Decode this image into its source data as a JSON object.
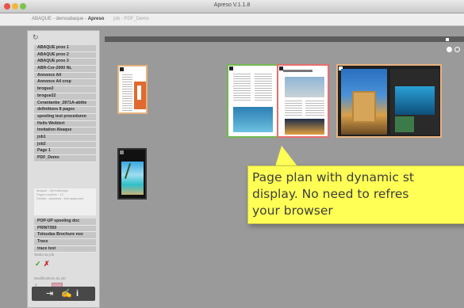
{
  "window": {
    "title": "Apreso V.1.1.8"
  },
  "toolbar": {
    "breadcrumb_left": "ABAQUE - demoabaque -",
    "breadcrumb_bold": "Apreso",
    "breadcrumb_job": "job - PDF_Demo"
  },
  "sidebar": {
    "items": [
      "ABAQUE proo 1",
      "ABAQUE proo 2",
      "ABAQUE proo 3",
      "ABR-Cor-2000 NL",
      "Annonce A4",
      "Annonce A4 crop",
      "brogue2",
      "brogue22",
      "Cerantanbe_2871A-abitte",
      "definitions 8 pages",
      "spoeling test proceduren",
      "Hello Weiblert",
      "Invitation Abaque",
      "job1",
      "job2",
      "Page 1",
      "PDF_Demo"
    ],
    "info_lines": [
      "abaque - demoabaque",
      "Pages number : 12",
      "Details : standard - test approved"
    ],
    "items2": [
      "POP-UP spoeling doc",
      "PRINT050",
      "Toloudas Brochure nox",
      "Trace",
      "trace test"
    ],
    "status_label": "Statut du job",
    "modif_label": "Modifications du job",
    "modif_count": "1"
  },
  "bottom_icons": [
    "logout-icon",
    "signature-icon",
    "info-icon"
  ],
  "tooltip": {
    "line1": "Page plan with dynamic st",
    "line2": "display. No need to refres",
    "line3": "your browser"
  },
  "colors": {
    "approved": "#72b94f",
    "rejected": "#e96d6d",
    "pending": "#e7b37f",
    "tooltip": "#ffff55"
  }
}
